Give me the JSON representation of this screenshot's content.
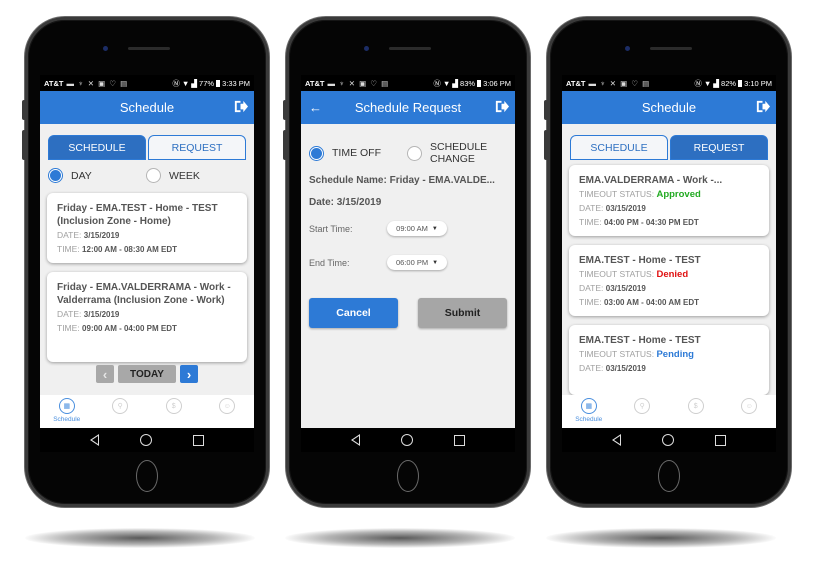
{
  "phones": [
    {
      "status_bar": {
        "carrier": "AT&T",
        "battery": "77%",
        "time": "3:33 PM"
      },
      "header": {
        "title": "Schedule",
        "logout_icon": "logout-icon"
      },
      "tabs": [
        {
          "label": "SCHEDULE",
          "active": true
        },
        {
          "label": "REQUEST",
          "active": false
        }
      ],
      "view_options": [
        {
          "label": "DAY",
          "selected": true
        },
        {
          "label": "WEEK",
          "selected": false
        }
      ],
      "cards": [
        {
          "title": "Friday - EMA.TEST - Home - TEST (Inclusion Zone - Home)",
          "date_label": "DATE:",
          "date": "3/15/2019",
          "time_label": "TIME:",
          "time": "12:00 AM - 08:30 AM EDT"
        },
        {
          "title": "Friday - EMA.VALDERRAMA - Work - Valderrama (Inclusion Zone - Work)",
          "date_label": "DATE:",
          "date": "3/15/2019",
          "time_label": "TIME:",
          "time": "09:00 AM - 04:00 PM EDT"
        }
      ],
      "pager": {
        "prev": "‹",
        "today": "TODAY",
        "next": "›"
      },
      "bottom_nav": [
        {
          "label": "Schedule",
          "icon": "calendar-icon",
          "active": true
        },
        {
          "label": "",
          "icon": "location-icon"
        },
        {
          "label": "",
          "icon": "money-icon"
        },
        {
          "label": "",
          "icon": "profile-icon"
        }
      ]
    },
    {
      "status_bar": {
        "carrier": "AT&T",
        "battery": "83%",
        "time": "3:06 PM"
      },
      "header": {
        "title": "Schedule Request",
        "back": "←"
      },
      "request_types": [
        {
          "label": "TIME OFF",
          "selected": true
        },
        {
          "label": "SCHEDULE CHANGE",
          "selected": false
        }
      ],
      "schedule_name": "Schedule Name: Friday - EMA.VALDE...",
      "date": "Date: 3/15/2019",
      "start_time": {
        "label": "Start Time:",
        "value": "09:00 AM"
      },
      "end_time": {
        "label": "End Time:",
        "value": "06:00 PM"
      },
      "cancel": "Cancel",
      "submit": "Submit"
    },
    {
      "status_bar": {
        "carrier": "AT&T",
        "battery": "82%",
        "time": "3:10 PM"
      },
      "header": {
        "title": "Schedule"
      },
      "tabs": [
        {
          "label": "SCHEDULE",
          "active": false
        },
        {
          "label": "REQUEST",
          "active": true
        }
      ],
      "requests": [
        {
          "title": "EMA.VALDERRAMA - Work -...",
          "status_label": "TIMEOUT STATUS:",
          "status": "Approved",
          "date_label": "DATE:",
          "date": "03/15/2019",
          "time_label": "TIME:",
          "time": "04:00 PM - 04:30 PM EDT"
        },
        {
          "title": "EMA.TEST - Home - TEST",
          "status_label": "TIMEOUT STATUS:",
          "status": "Denied",
          "date_label": "DATE:",
          "date": "03/15/2019",
          "time_label": "TIME:",
          "time": "03:00 AM - 04:00 AM EDT"
        },
        {
          "title": "EMA.TEST - Home - TEST",
          "status_label": "TIMEOUT STATUS:",
          "status": "Pending",
          "date_label": "DATE:",
          "date": "03/15/2019"
        }
      ],
      "bottom_nav": [
        {
          "label": "Schedule",
          "active": true
        }
      ]
    }
  ],
  "colors": {
    "primary": "#2d7ad6",
    "approved": "#22aa22",
    "denied": "#e01010",
    "pending": "#2d7ad6"
  }
}
